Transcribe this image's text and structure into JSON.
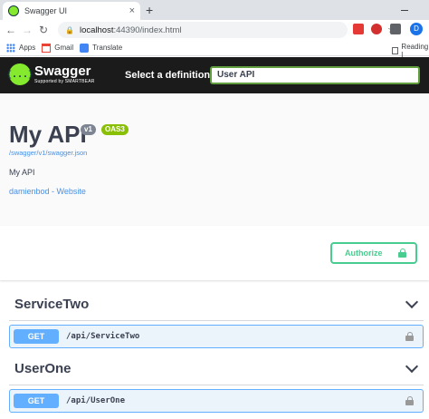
{
  "browser": {
    "tab_title": "Swagger UI",
    "tab_close": "×",
    "new_tab": "+",
    "url_host": "localhost",
    "url_rest": ":44390/index.html",
    "profile_initial": "D",
    "bookmarks": [
      {
        "label": "Apps",
        "icon": "apps-grid-icon"
      },
      {
        "label": "Gmail",
        "icon": "gmail-icon"
      },
      {
        "label": "Translate",
        "icon": "translate-icon"
      }
    ],
    "reading_list": "Reading l"
  },
  "topbar": {
    "brand": "Swagger",
    "brand_sub": "Supported by SMARTBEAR",
    "definition_label": "Select a definition",
    "definition_value": "User API",
    "logo_glyph": "{...}"
  },
  "info": {
    "title": "My API",
    "version_badge": "v1",
    "oas_badge": "OAS3",
    "spec_url": "/swagger/v1/swagger.json",
    "description": "My API",
    "contact": "damienbod - Website"
  },
  "auth": {
    "authorize_label": "Authorize"
  },
  "sections": [
    {
      "name": "ServiceTwo",
      "operations": [
        {
          "method": "GET",
          "path": "/api/ServiceTwo"
        }
      ]
    },
    {
      "name": "UserOne",
      "operations": [
        {
          "method": "GET",
          "path": "/api/UserOne"
        }
      ]
    }
  ],
  "colors": {
    "get_method": "#61affe",
    "authorize": "#49cc90",
    "swagger_green": "#85ea2d"
  }
}
